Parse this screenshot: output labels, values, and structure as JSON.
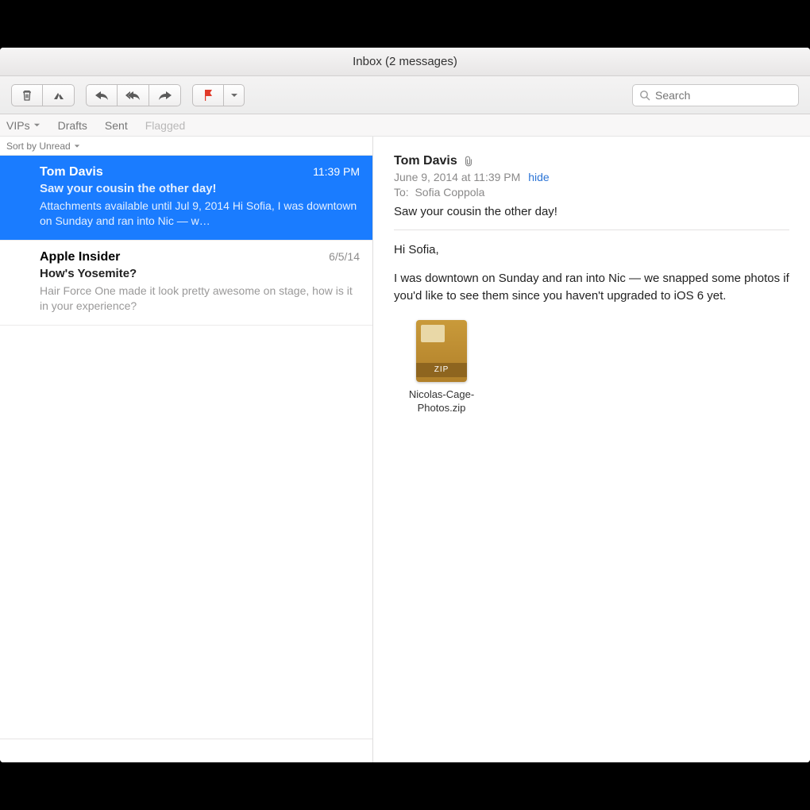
{
  "window": {
    "title": "Inbox (2 messages)"
  },
  "toolbar": {
    "search_placeholder": "Search"
  },
  "favorites": {
    "item0": "VIPs",
    "item1": "Drafts",
    "item2": "Sent",
    "item3": "Flagged"
  },
  "list": {
    "sort_label": "Sort by Unread",
    "messages": [
      {
        "sender": "Tom Davis",
        "date": "11:39 PM",
        "subject": "Saw your cousin the other day!",
        "preview": "Attachments available until Jul 9, 2014 Hi Sofia, I was downtown on Sunday and ran into Nic — w…"
      },
      {
        "sender": "Apple Insider",
        "date": "6/5/14",
        "subject": "How's Yosemite?",
        "preview": "Hair Force One made it look pretty awesome on stage, how is it in your experience?"
      }
    ]
  },
  "reader": {
    "from": "Tom Davis",
    "datetime": "June 9, 2014 at 11:39 PM",
    "hide_label": "hide",
    "to_label": "To:",
    "to_name": "Sofia Coppola",
    "subject": "Saw your cousin the other day!",
    "greeting": "Hi Sofia,",
    "paragraph1": "I was downtown on Sunday and ran into Nic — we snapped some photos if you'd like to see them since you haven't upgraded to iOS 6 yet.",
    "attachment_name": "Nicolas-Cage-Photos.zip"
  }
}
